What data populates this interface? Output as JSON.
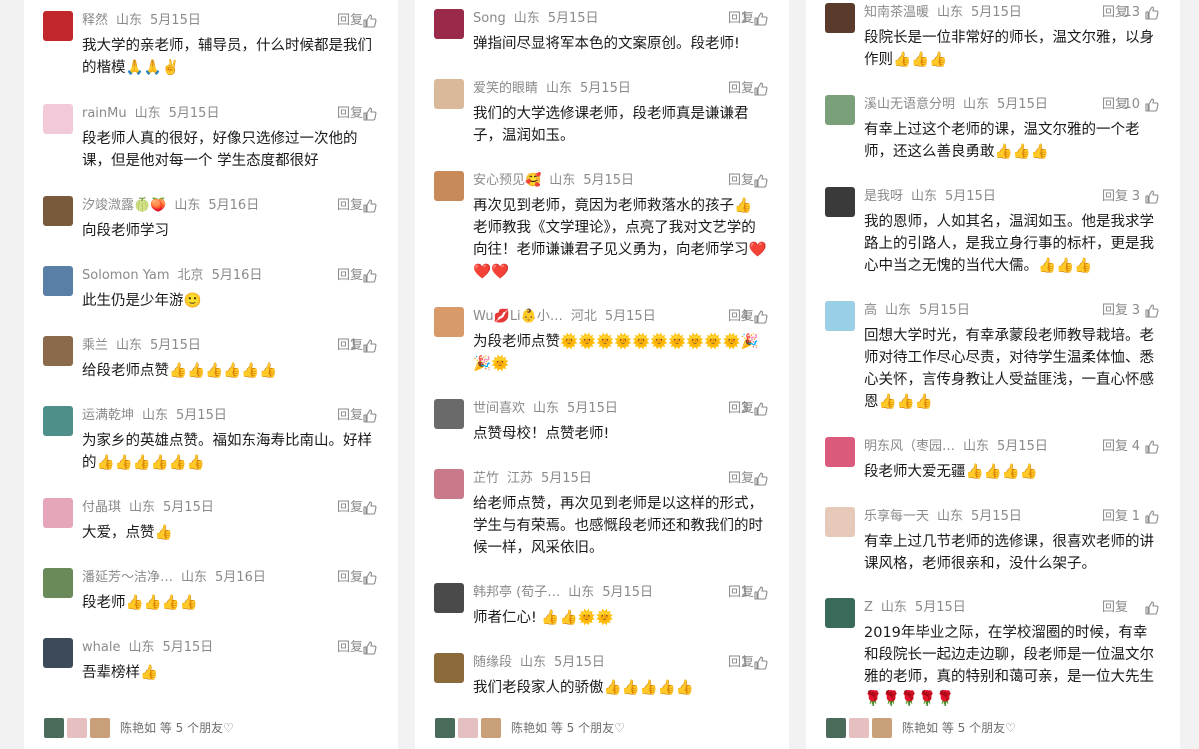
{
  "reply_label": "回复",
  "footer": {
    "friends_text": "陈艳如 等 5 个朋友♡"
  },
  "columns": [
    [
      {
        "name": "释然",
        "loc": "山东",
        "date": "5月15日",
        "likes": "",
        "text": "我大学的亲老师，辅导员，什么时候都是我们的楷模🙏🙏✌️",
        "avatar_color": "#c0262a"
      },
      {
        "name": "rainMu",
        "loc": "山东",
        "date": "5月15日",
        "likes": "",
        "text": "段老师人真的很好，好像只选修过一次他的课，但是他对每一个 学生态度都很好",
        "avatar_color": "#f2c9d8"
      },
      {
        "name": "汐竣溦露🍈🍑",
        "loc": "山东",
        "date": "5月16日",
        "likes": "",
        "text": "向段老师学习",
        "avatar_color": "#7a5a3c"
      },
      {
        "name": "Solomon Yam",
        "loc": "北京",
        "date": "5月16日",
        "likes": "",
        "text": "此生仍是少年游🙂",
        "avatar_color": "#5a7fa6"
      },
      {
        "name": "乘兰",
        "loc": "山东",
        "date": "5月15日",
        "likes": "1",
        "text": "给段老师点赞👍👍👍👍👍👍",
        "avatar_color": "#8a6a4a"
      },
      {
        "name": "运满乾坤",
        "loc": "山东",
        "date": "5月15日",
        "likes": "",
        "text": "为家乡的英雄点赞。福如东海寿比南山。好样的👍👍👍👍👍👍",
        "avatar_color": "#4f8f8a"
      },
      {
        "name": "付晶琪",
        "loc": "山东",
        "date": "5月15日",
        "likes": "",
        "text": "大爱，点赞👍",
        "avatar_color": "#e6a6b9"
      },
      {
        "name": "潘延芳～洁净…",
        "loc": "山东",
        "date": "5月16日",
        "likes": "",
        "text": "段老师👍👍👍👍",
        "avatar_color": "#6b8a5a"
      },
      {
        "name": "whale",
        "loc": "山东",
        "date": "5月15日",
        "likes": "",
        "text": "吾辈榜样👍",
        "avatar_color": "#3d4a5a"
      }
    ],
    [
      {
        "name": "Song",
        "loc": "山东",
        "date": "5月15日",
        "likes": "1",
        "text": "弹指间尽显将军本色的文案原创。段老师!",
        "avatar_color": "#9a2a4a"
      },
      {
        "name": "爱笑的眼睛",
        "loc": "山东",
        "date": "5月15日",
        "likes": "",
        "text": "我们的大学选修课老师，段老师真是谦谦君子，温润如玉。",
        "avatar_color": "#d9b99a"
      },
      {
        "name": "安心预见🥰",
        "loc": "山东",
        "date": "5月15日",
        "likes": "",
        "text": "再次见到老师，竟因为老师救落水的孩子👍 老师教我《文学理论》，点亮了我对文艺学的向往！老师谦谦君子见义勇为，向老师学习❤️❤️❤️",
        "avatar_color": "#c98a5a"
      },
      {
        "name": "Wu💋Li👶小…",
        "loc": "河北",
        "date": "5月15日",
        "likes": "4",
        "text": "为段老师点赞🌞🌞🌞🌞🌞🌞🌞🌞🌞🌞🎉🎉🌞",
        "avatar_color": "#d99a6a"
      },
      {
        "name": "世间喜欢",
        "loc": "山东",
        "date": "5月15日",
        "likes": "3",
        "text": "点赞母校！点赞老师!",
        "avatar_color": "#6a6a6a"
      },
      {
        "name": "芷竹",
        "loc": "江苏",
        "date": "5月15日",
        "likes": "",
        "text": "给老师点赞，再次见到老师是以这样的形式，学生与有荣焉。也感慨段老师还和教我们的时候一样，风采依旧。",
        "avatar_color": "#c97a8a"
      },
      {
        "name": "韩邦亭 (荀子…",
        "loc": "山东",
        "date": "5月15日",
        "likes": "1",
        "text": "师者仁心! 👍👍🌞🌞",
        "avatar_color": "#4a4a4a"
      },
      {
        "name": "随缘段",
        "loc": "山东",
        "date": "5月15日",
        "likes": "1",
        "text": "我们老段家人的骄傲👍👍👍👍👍",
        "avatar_color": "#8a6a3a"
      }
    ],
    [
      {
        "name": "知南茶温暖",
        "loc": "山东",
        "date": "5月15日",
        "likes": "13",
        "text": "段院长是一位非常好的师长，温文尔雅，以身作则👍👍👍",
        "avatar_color": "#5a3a2a"
      },
      {
        "name": "溪山无语意分明",
        "loc": "山东",
        "date": "5月15日",
        "likes": "10",
        "text": "有幸上过这个老师的课，温文尔雅的一个老师，还这么善良勇敢👍👍👍",
        "avatar_color": "#7aa07a"
      },
      {
        "name": "是我呀",
        "loc": "山东",
        "date": "5月15日",
        "likes": "3",
        "text": "我的恩师，人如其名，温润如玉。他是我求学路上的引路人，是我立身行事的标杆，更是我心中当之无愧的当代大儒。👍👍👍",
        "avatar_color": "#3a3a3a"
      },
      {
        "name": "高",
        "loc": "山东",
        "date": "5月15日",
        "likes": "3",
        "text": "回想大学时光，有幸承蒙段老师教导栽培。老师对待工作尽心尽责，对待学生温柔体恤、悉心关怀，言传身教让人受益匪浅，一直心怀感恩👍👍👍",
        "avatar_color": "#9ad0e6"
      },
      {
        "name": "明东风（枣园…",
        "loc": "山东",
        "date": "5月15日",
        "likes": "4",
        "text": "段老师大爱无疆👍👍👍👍",
        "avatar_color": "#d95a7a"
      },
      {
        "name": "乐享每一天",
        "loc": "山东",
        "date": "5月15日",
        "likes": "1",
        "text": "有幸上过几节老师的选修课，很喜欢老师的讲课风格，老师很亲和，没什么架子。",
        "avatar_color": "#e6c9b9"
      },
      {
        "name": "Z",
        "loc": "山东",
        "date": "5月15日",
        "likes": "",
        "text": "2019年毕业之际，在学校溜圈的时候，有幸和段院长一起边走边聊，段老师是一位温文尔雅的老师，真的特别和蔼可亲，是一位大先生🌹🌹🌹🌹🌹",
        "avatar_color": "#3a6a5a"
      }
    ]
  ]
}
